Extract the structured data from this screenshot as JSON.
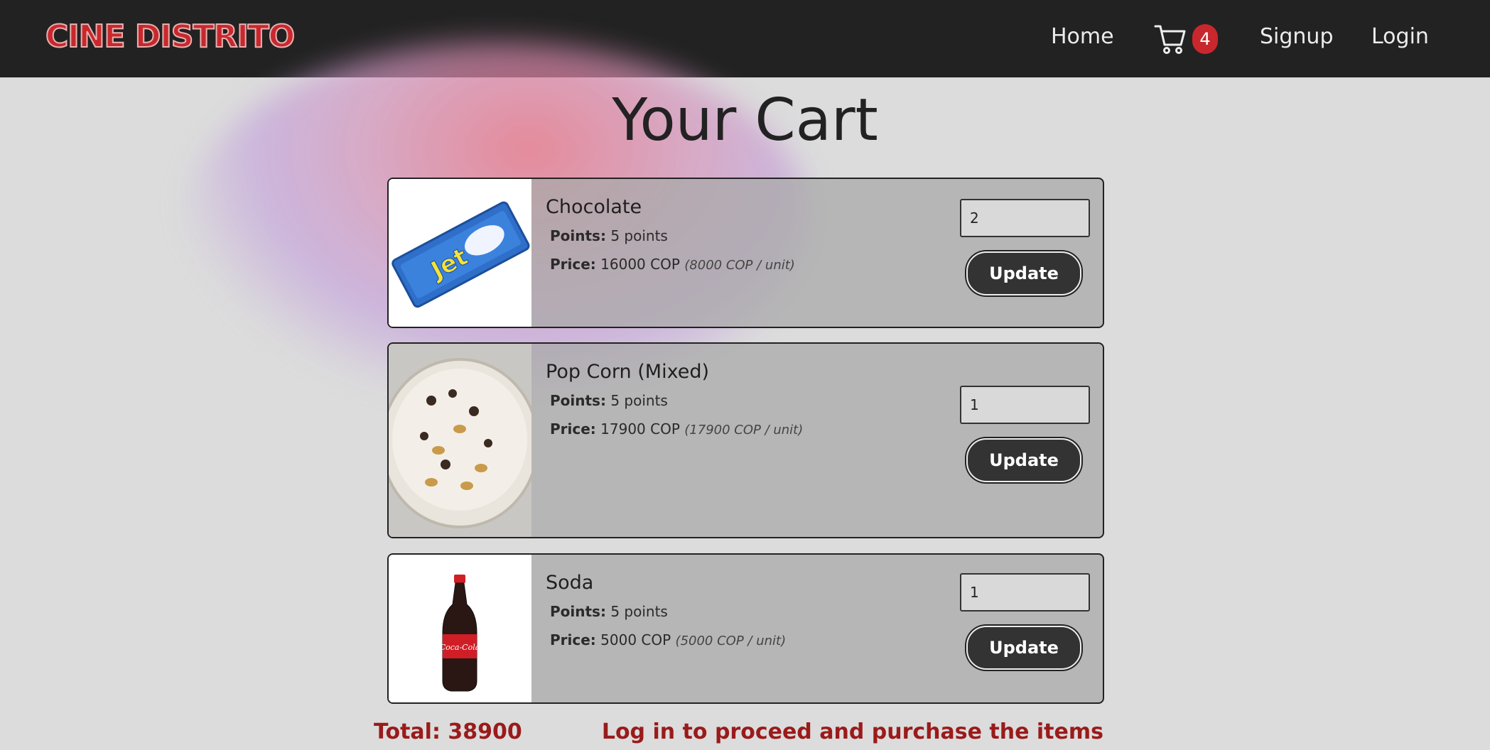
{
  "navbar": {
    "brand": "CINE DISTRITO",
    "links": {
      "home": "Home",
      "signup": "Signup",
      "login": "Login"
    },
    "cart_count": "4",
    "colors": {
      "bar": "#222222",
      "brand": "#c8282d",
      "badge": "#c8282d"
    }
  },
  "page": {
    "title": "Your Cart"
  },
  "items": [
    {
      "name": "Chocolate",
      "points_label": "Points:",
      "points": "5 points",
      "price_label": "Price:",
      "price": "16000 COP",
      "unit_price": "(8000 COP / unit)",
      "quantity": "2",
      "update_label": "Update",
      "image_icon": "chocolate-bar-image"
    },
    {
      "name": "Pop Corn (Mixed)",
      "points_label": "Points:",
      "points": "5 points",
      "price_label": "Price:",
      "price": "17900 COP",
      "unit_price": "(17900 COP / unit)",
      "quantity": "1",
      "update_label": "Update",
      "image_icon": "popcorn-bowl-image"
    },
    {
      "name": "Soda",
      "points_label": "Points:",
      "points": "5 points",
      "price_label": "Price:",
      "price": "5000 COP",
      "unit_price": "(5000 COP / unit)",
      "quantity": "1",
      "update_label": "Update",
      "image_icon": "soda-bottle-image"
    }
  ],
  "footer": {
    "total": "Total: 38900",
    "login_message": "Log in to proceed and purchase the items"
  }
}
